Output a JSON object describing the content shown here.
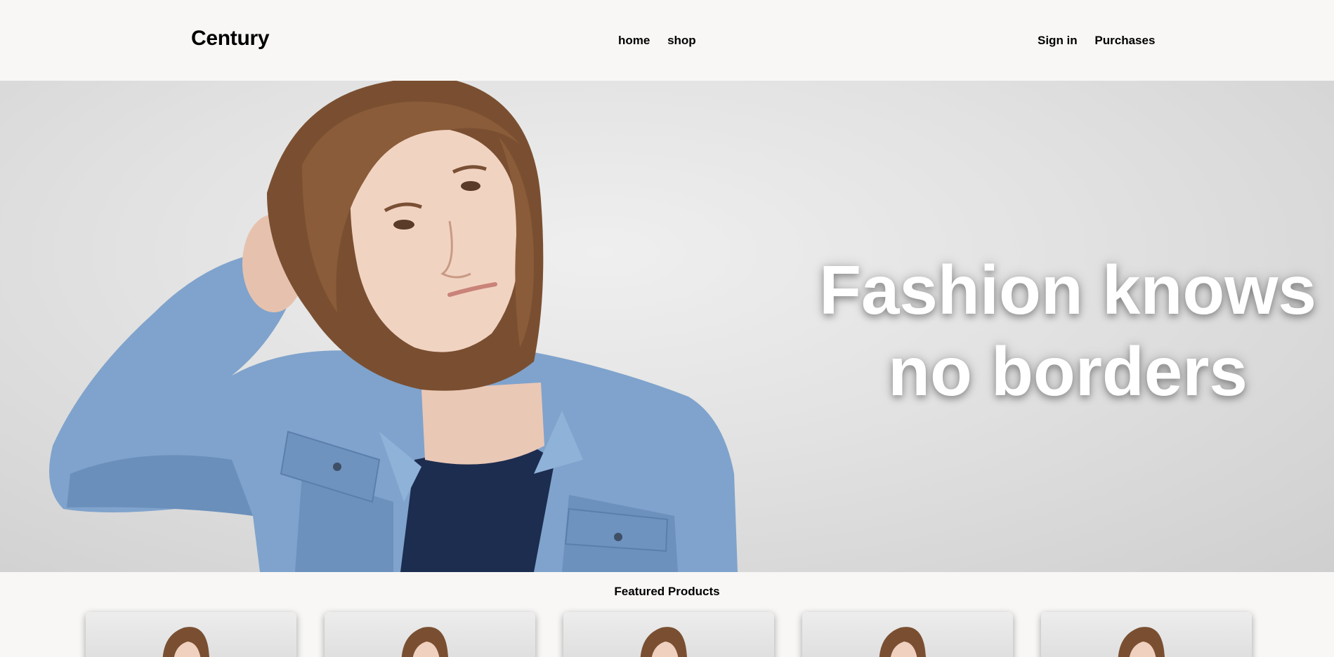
{
  "header": {
    "brand": "Century",
    "nav_center": [
      {
        "label": "home"
      },
      {
        "label": "shop"
      }
    ],
    "nav_right": [
      {
        "label": "Sign in"
      },
      {
        "label": "Purchases"
      }
    ]
  },
  "hero": {
    "headline_line1": "Fashion knows",
    "headline_line2": "no borders"
  },
  "featured": {
    "title": "Featured Products",
    "cards": [
      {
        "image": "product-model-photo"
      },
      {
        "image": "product-model-photo"
      },
      {
        "image": "product-model-photo"
      },
      {
        "image": "product-model-photo"
      },
      {
        "image": "product-model-photo"
      }
    ]
  },
  "colors": {
    "background": "#f8f7f6",
    "text": "#000000",
    "headline": "#ffffff"
  }
}
